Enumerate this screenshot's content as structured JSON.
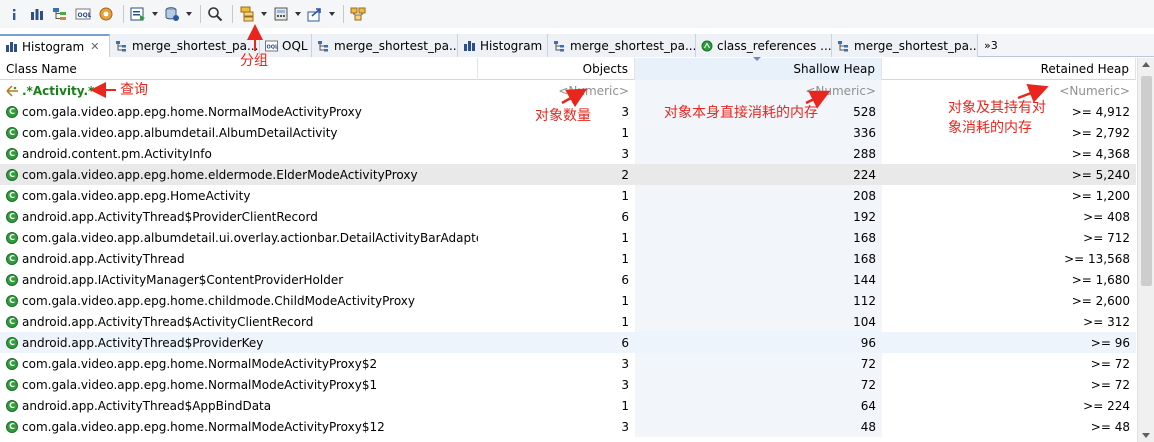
{
  "toolbar": {
    "icons": [
      "info-icon",
      "histogram-icon",
      "dominator-tree-icon",
      "oql-icon",
      "heap-dump-overview-icon",
      "run-report-icon",
      "query-browser-icon",
      "search-icon",
      "group-by-icon",
      "calculate-retained-icon",
      "export-icon",
      "compare-icon"
    ]
  },
  "tabs": [
    {
      "label": "Histogram",
      "icon": "histogram-icon",
      "closable": true
    },
    {
      "label": "merge_shortest_pa...",
      "icon": "tree-icon"
    },
    {
      "label": "OQL",
      "icon": "oql-icon"
    },
    {
      "label": "merge_shortest_pa...",
      "icon": "tree-icon"
    },
    {
      "label": "Histogram",
      "icon": "histogram-icon"
    },
    {
      "label": "merge_shortest_pa...",
      "icon": "tree-icon"
    },
    {
      "label": "class_references ...",
      "icon": "class-references-icon"
    },
    {
      "label": "merge_shortest_pa...",
      "icon": "tree-icon"
    }
  ],
  "tabs_more": "»3",
  "columns": [
    "Class Name",
    "Objects",
    "Shallow Heap",
    "Retained Heap"
  ],
  "filter_row": {
    "class_name": ".*Activity.*",
    "objects": "<Numeric>",
    "shallow": "<Numeric>",
    "retained": "<Numeric>"
  },
  "rows": [
    {
      "name": "com.gala.video.app.epg.home.NormalModeActivityProxy",
      "objects": "3",
      "shallow": "528",
      "retained": ">= 4,912"
    },
    {
      "name": "com.gala.video.app.albumdetail.AlbumDetailActivity",
      "objects": "1",
      "shallow": "336",
      "retained": ">= 2,792"
    },
    {
      "name": "android.content.pm.ActivityInfo",
      "objects": "3",
      "shallow": "288",
      "retained": ">= 4,368"
    },
    {
      "name": "com.gala.video.app.epg.home.eldermode.ElderModeActivityProxy",
      "objects": "2",
      "shallow": "224",
      "retained": ">= 5,240"
    },
    {
      "name": "com.gala.video.app.epg.HomeActivity",
      "objects": "1",
      "shallow": "208",
      "retained": ">= 1,200"
    },
    {
      "name": "android.app.ActivityThread$ProviderClientRecord",
      "objects": "6",
      "shallow": "192",
      "retained": ">= 408"
    },
    {
      "name": "com.gala.video.app.albumdetail.ui.overlay.actionbar.DetailActivityBarAdapter",
      "objects": "1",
      "shallow": "168",
      "retained": ">= 712"
    },
    {
      "name": "android.app.ActivityThread",
      "objects": "1",
      "shallow": "168",
      "retained": ">= 13,568"
    },
    {
      "name": "android.app.IActivityManager$ContentProviderHolder",
      "objects": "6",
      "shallow": "144",
      "retained": ">= 1,680"
    },
    {
      "name": "com.gala.video.app.epg.home.childmode.ChildModeActivityProxy",
      "objects": "1",
      "shallow": "112",
      "retained": ">= 2,600"
    },
    {
      "name": "android.app.ActivityThread$ActivityClientRecord",
      "objects": "1",
      "shallow": "104",
      "retained": ">= 312"
    },
    {
      "name": "android.app.ActivityThread$ProviderKey",
      "objects": "6",
      "shallow": "96",
      "retained": ">= 96"
    },
    {
      "name": "com.gala.video.app.epg.home.NormalModeActivityProxy$2",
      "objects": "3",
      "shallow": "72",
      "retained": ">= 72"
    },
    {
      "name": "com.gala.video.app.epg.home.NormalModeActivityProxy$1",
      "objects": "3",
      "shallow": "72",
      "retained": ">= 72"
    },
    {
      "name": "android.app.ActivityThread$AppBindData",
      "objects": "1",
      "shallow": "64",
      "retained": ">= 224"
    },
    {
      "name": "com.gala.video.app.epg.home.NormalModeActivityProxy$12",
      "objects": "3",
      "shallow": "48",
      "retained": ">= 48"
    }
  ],
  "annotations": {
    "group": "分组",
    "query": "查询",
    "objects": "对象数量",
    "shallow": "对象本身直接消耗的内存",
    "retained_line1": "对象及其持有对",
    "retained_line2": "象消耗的内存"
  },
  "colors": {
    "annotation": "#e8261e",
    "filter_text": "#1a7f1a",
    "class_icon": "#2e9e3a"
  }
}
